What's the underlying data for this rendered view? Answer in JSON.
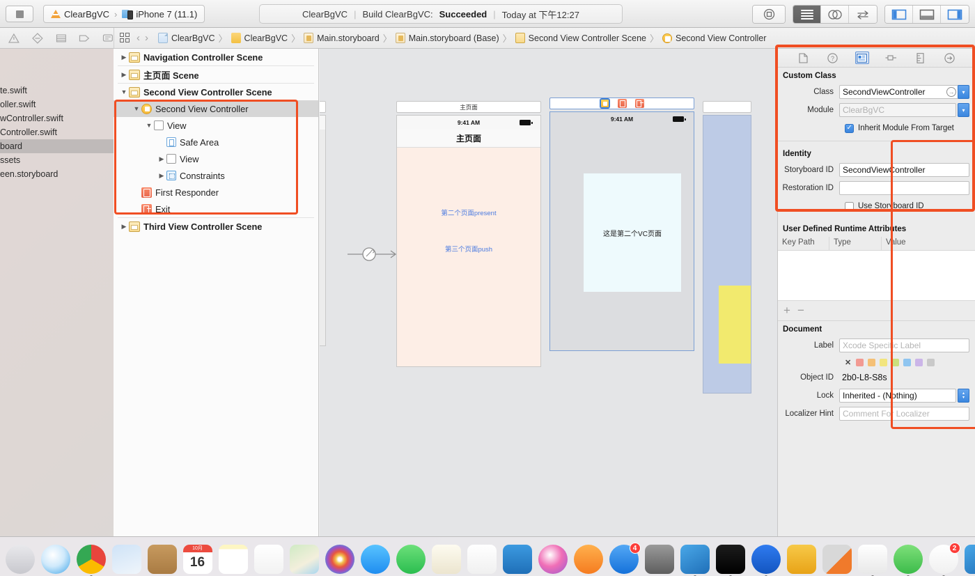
{
  "toolbar": {
    "stop_button": "stop-button",
    "scheme": {
      "app": "ClearBgVC",
      "separator": "›",
      "destination": "iPhone 7 (11.1)"
    },
    "status": {
      "project": "ClearBgVC",
      "divider": "|",
      "action": "Build ClearBgVC:",
      "result": "Succeeded",
      "time": "Today at 下午12:27"
    },
    "right_buttons": [
      {
        "name": "library-button",
        "glyph": "◎"
      },
      {
        "name": "standard-editor-button",
        "glyph": "lines"
      },
      {
        "name": "assistant-editor-button",
        "glyph": "◎◎"
      },
      {
        "name": "version-editor-button",
        "glyph": "⇄"
      },
      {
        "name": "toggle-navigator-button",
        "glyph": "left-pane"
      },
      {
        "name": "toggle-debug-area-button",
        "glyph": "bottom-pane"
      },
      {
        "name": "toggle-utilities-button",
        "glyph": "right-pane"
      }
    ]
  },
  "jumpbar": {
    "left_icons": [
      "warning-icon",
      "error-icon",
      "list-icon",
      "tag-icon",
      "comment-icon"
    ],
    "back_label": "‹",
    "forward_label": "›",
    "breadcrumb": [
      {
        "label": "ClearBgVC",
        "icon": "project-icon"
      },
      {
        "label": "ClearBgVC",
        "icon": "folder-icon"
      },
      {
        "label": "Main.storyboard",
        "icon": "storyboard-icon"
      },
      {
        "label": "Main.storyboard (Base)",
        "icon": "storyboard-icon"
      },
      {
        "label": "Second View Controller Scene",
        "icon": "scene-icon"
      },
      {
        "label": "Second View Controller",
        "icon": "view-controller-icon"
      }
    ],
    "separator": "〉"
  },
  "project_navigator": {
    "files": [
      "te.swift",
      "oller.swift",
      "wController.swift",
      "Controller.swift",
      "board",
      "ssets",
      "een.storyboard"
    ],
    "selected_index": 4
  },
  "outline": {
    "rows": [
      {
        "label": "Navigation Controller Scene",
        "indent": 0,
        "icon": "scene-icon",
        "tri": "right",
        "bold": true,
        "selected": false
      },
      {
        "label": "主页面 Scene",
        "indent": 0,
        "icon": "scene-icon",
        "tri": "right",
        "bold": true,
        "selected": false
      },
      {
        "label": "Second View Controller Scene",
        "indent": 0,
        "icon": "scene-icon",
        "tri": "down",
        "bold": true,
        "selected": false
      },
      {
        "label": "Second View Controller",
        "indent": 1,
        "icon": "view-controller-icon",
        "tri": "down",
        "bold": false,
        "selected": true
      },
      {
        "label": "View",
        "indent": 2,
        "icon": "view-icon",
        "tri": "down",
        "bold": false,
        "selected": false
      },
      {
        "label": "Safe Area",
        "indent": 3,
        "icon": "safe-area-icon",
        "tri": "none",
        "bold": false,
        "selected": false
      },
      {
        "label": "View",
        "indent": 3,
        "icon": "view-icon",
        "tri": "right",
        "bold": false,
        "selected": false
      },
      {
        "label": "Constraints",
        "indent": 3,
        "icon": "constraints-icon",
        "tri": "right",
        "bold": false,
        "selected": false
      },
      {
        "label": "First Responder",
        "indent": 1,
        "icon": "first-responder-icon",
        "tri": "none",
        "bold": false,
        "selected": false
      },
      {
        "label": "Exit",
        "indent": 1,
        "icon": "exit-icon",
        "tri": "none",
        "bold": false,
        "selected": false
      },
      {
        "label": "Third View Controller Scene",
        "indent": 0,
        "icon": "scene-icon",
        "tri": "right",
        "bold": true,
        "selected": false
      }
    ]
  },
  "canvas": {
    "main_vc": {
      "scene_bar_label": "主页面",
      "status_time": "9:41 AM",
      "nav_title": "主页面",
      "link1": "第二个页面present",
      "link2": "第三个页面push"
    },
    "second_vc": {
      "status_time": "9:41 AM",
      "label": "这是第二个VC页面",
      "scene_dock_icons": [
        "view-controller-icon",
        "first-responder-icon",
        "exit-icon"
      ]
    }
  },
  "inspector": {
    "tabs": [
      {
        "name": "file-inspector-tab",
        "active": false
      },
      {
        "name": "quick-help-inspector-tab",
        "active": false
      },
      {
        "name": "identity-inspector-tab",
        "active": true
      },
      {
        "name": "attributes-inspector-tab",
        "active": false
      },
      {
        "name": "size-inspector-tab",
        "active": false
      },
      {
        "name": "connections-inspector-tab",
        "active": false
      }
    ],
    "custom_class": {
      "section_title": "Custom Class",
      "class_label": "Class",
      "class_value": "SecondViewController",
      "module_label": "Module",
      "module_placeholder": "ClearBgVC",
      "inherit_label": "Inherit Module From Target",
      "inherit_checked": true
    },
    "identity": {
      "section_title": "Identity",
      "storyboard_id_label": "Storyboard ID",
      "storyboard_id_value": "SecondViewController",
      "restoration_id_label": "Restoration ID",
      "restoration_id_value": "",
      "use_storyboard_id_label": "Use Storyboard ID",
      "use_storyboard_id_checked": false
    },
    "runtime_attributes": {
      "section_title": "User Defined Runtime Attributes",
      "columns": [
        "Key Path",
        "Type",
        "Value"
      ],
      "rows": [],
      "add_button": "+",
      "remove_button": "−"
    },
    "document": {
      "section_title": "Document",
      "label_label": "Label",
      "label_placeholder": "Xcode Specific Label",
      "color_clear": "✕",
      "colors": [
        "#f29a92",
        "#f5c076",
        "#f2e57e",
        "#cbe07e",
        "#8fc5f0",
        "#cbb5e8",
        "#c9c9c9"
      ],
      "object_id_label": "Object ID",
      "object_id_value": "2b0-L8-S8s",
      "lock_label": "Lock",
      "lock_value": "Inherited - (Nothing)",
      "localizer_hint_label": "Localizer Hint",
      "localizer_hint_placeholder": "Comment For Localizer"
    }
  },
  "highlights": {
    "accent_color": "#f04e23",
    "regions": [
      "outline-second-view-controller-scene",
      "canvas-second-view-controller",
      "inspector-identity-section"
    ]
  },
  "dock": {
    "items": [
      {
        "name": "finder",
        "running": true
      },
      {
        "name": "siri",
        "running": false
      },
      {
        "name": "launchpad",
        "running": false
      },
      {
        "name": "safari",
        "running": false
      },
      {
        "name": "chrome",
        "running": true
      },
      {
        "name": "photos-app",
        "running": false
      },
      {
        "name": "contacts",
        "running": false
      },
      {
        "name": "calendar",
        "running": false,
        "badge": "16"
      },
      {
        "name": "notes",
        "running": false
      },
      {
        "name": "reminders",
        "running": false
      },
      {
        "name": "maps",
        "running": false
      },
      {
        "name": "photos",
        "running": false
      },
      {
        "name": "messages",
        "running": false
      },
      {
        "name": "facetime",
        "running": false
      },
      {
        "name": "pages",
        "running": false
      },
      {
        "name": "numbers",
        "running": false
      },
      {
        "name": "keynote",
        "running": false
      },
      {
        "name": "itunes",
        "running": false
      },
      {
        "name": "ibooks",
        "running": false
      },
      {
        "name": "app-store",
        "running": false,
        "badge": "4"
      },
      {
        "name": "system-preferences",
        "running": false
      },
      {
        "name": "xcode",
        "running": true
      },
      {
        "name": "terminal",
        "running": true
      },
      {
        "name": "1password",
        "running": true
      },
      {
        "name": "sketch",
        "running": false
      },
      {
        "name": "calculator",
        "running": false
      },
      {
        "name": "qq",
        "running": true
      },
      {
        "name": "wechat",
        "running": true
      },
      {
        "name": "todo-app",
        "running": true,
        "badge": "2"
      },
      {
        "name": "simulator",
        "running": true
      },
      {
        "name": "downloads-stack",
        "running": false
      }
    ]
  }
}
